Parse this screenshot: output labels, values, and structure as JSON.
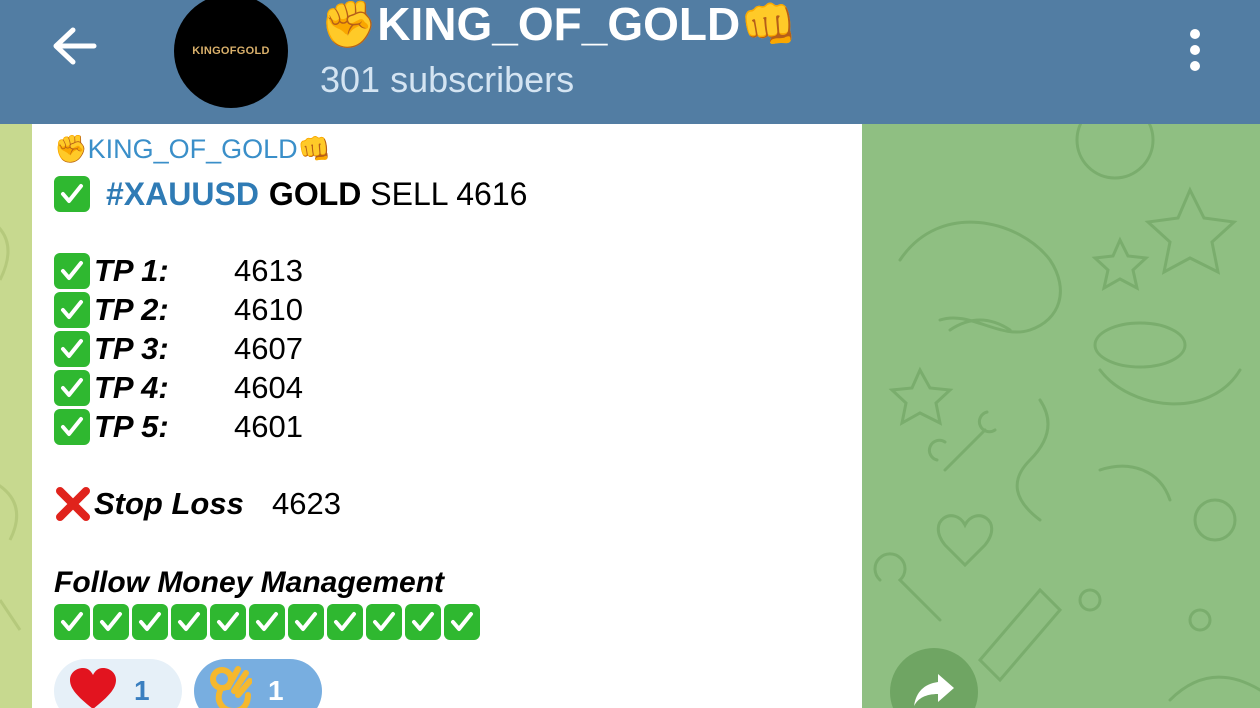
{
  "header": {
    "title": "✊KING_OF_GOLD👊",
    "subscribers": "301 subscribers",
    "avatar_text": "KINGOFGOLD"
  },
  "message": {
    "author": "✊KING_OF_GOLD👊",
    "headline": {
      "hashtag": "#XAUUSD",
      "asset": "GOLD",
      "rest": " SELL 4616"
    },
    "take_profits": [
      {
        "label": "TP 1:",
        "value": "4613"
      },
      {
        "label": "TP 2:",
        "value": "4610"
      },
      {
        "label": "TP 3:",
        "value": "4607"
      },
      {
        "label": "TP 4:",
        "value": "4604"
      },
      {
        "label": "TP 5:",
        "value": "4601"
      }
    ],
    "stop_loss": {
      "label": "Stop Loss",
      "value": "4623"
    },
    "note": "Follow Money Management",
    "check_count": 11
  },
  "reactions": [
    {
      "emoji": "heart",
      "count": "1"
    },
    {
      "emoji": "ok-hand",
      "count": "1"
    }
  ],
  "icons": {
    "back": "arrow-left-icon",
    "menu": "more-vertical-icon",
    "check": "check-mark-button-icon",
    "cross": "cross-mark-icon",
    "share": "share-arrow-icon"
  },
  "colors": {
    "header_bg": "#527da3",
    "wallpaper": "#8fbf82",
    "link_blue": "#3a8fc9",
    "check_green": "#2fb830",
    "cross_red": "#e0231c"
  }
}
